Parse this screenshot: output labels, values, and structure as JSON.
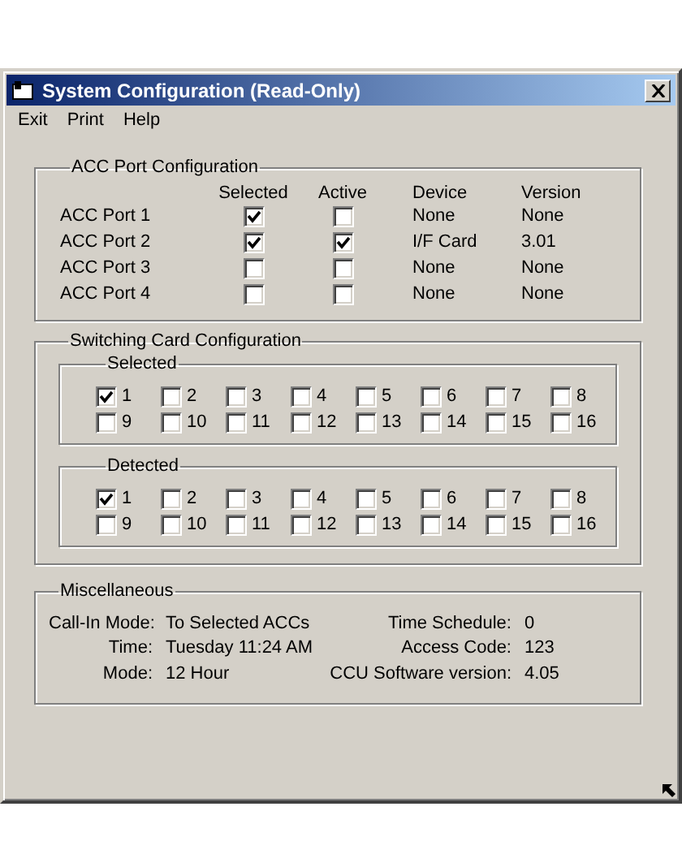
{
  "window": {
    "title": "System Configuration (Read-Only)"
  },
  "menu": [
    "Exit",
    "Print",
    "Help"
  ],
  "acc_ports": {
    "title": "ACC Port Configuration",
    "columns": [
      "Selected",
      "Active",
      "Device",
      "Version"
    ],
    "rows": [
      {
        "name": "ACC Port 1",
        "selected": true,
        "active": false,
        "device": "None",
        "version": "None"
      },
      {
        "name": "ACC Port 2",
        "selected": true,
        "active": true,
        "device": "I/F Card",
        "version": "3.01"
      },
      {
        "name": "ACC Port 3",
        "selected": false,
        "active": false,
        "device": "None",
        "version": "None"
      },
      {
        "name": "ACC Port 4",
        "selected": false,
        "active": false,
        "device": "None",
        "version": "None"
      }
    ]
  },
  "switching": {
    "title": "Switching Card Configuration",
    "groups": [
      {
        "title": "Selected",
        "cards": [
          {
            "label": "1",
            "checked": true
          },
          {
            "label": "2",
            "checked": false
          },
          {
            "label": "3",
            "checked": false
          },
          {
            "label": "4",
            "checked": false
          },
          {
            "label": "5",
            "checked": false
          },
          {
            "label": "6",
            "checked": false
          },
          {
            "label": "7",
            "checked": false
          },
          {
            "label": "8",
            "checked": false
          },
          {
            "label": "9",
            "checked": false
          },
          {
            "label": "10",
            "checked": false
          },
          {
            "label": "11",
            "checked": false
          },
          {
            "label": "12",
            "checked": false
          },
          {
            "label": "13",
            "checked": false
          },
          {
            "label": "14",
            "checked": false
          },
          {
            "label": "15",
            "checked": false
          },
          {
            "label": "16",
            "checked": false
          }
        ]
      },
      {
        "title": "Detected",
        "cards": [
          {
            "label": "1",
            "checked": true
          },
          {
            "label": "2",
            "checked": false
          },
          {
            "label": "3",
            "checked": false
          },
          {
            "label": "4",
            "checked": false
          },
          {
            "label": "5",
            "checked": false
          },
          {
            "label": "6",
            "checked": false
          },
          {
            "label": "7",
            "checked": false
          },
          {
            "label": "8",
            "checked": false
          },
          {
            "label": "9",
            "checked": false
          },
          {
            "label": "10",
            "checked": false
          },
          {
            "label": "11",
            "checked": false
          },
          {
            "label": "12",
            "checked": false
          },
          {
            "label": "13",
            "checked": false
          },
          {
            "label": "14",
            "checked": false
          },
          {
            "label": "15",
            "checked": false
          },
          {
            "label": "16",
            "checked": false
          }
        ]
      }
    ]
  },
  "misc": {
    "title": "Miscellaneous",
    "rows": [
      {
        "label": "Call-In Mode:",
        "value": "To Selected ACCs",
        "label_2": "Time Schedule:",
        "value_2": "0"
      },
      {
        "label": "Time:",
        "value": "Tuesday 11:24 AM",
        "label_2": "Access Code:",
        "value_2": "123"
      },
      {
        "label": "Mode:",
        "value": "12 Hour",
        "label_2": "CCU Software version:",
        "value_2": "4.05"
      }
    ]
  }
}
